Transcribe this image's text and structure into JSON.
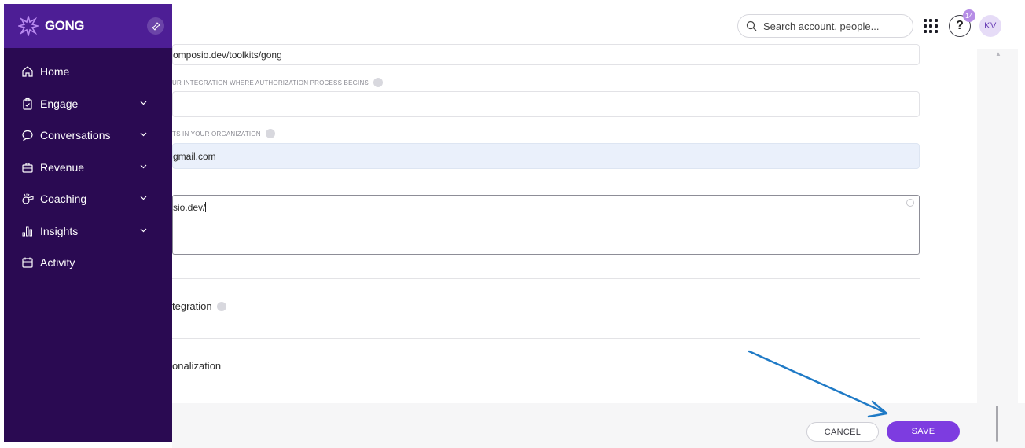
{
  "topbar": {
    "search_placeholder": "Search account, people...",
    "notif_count": "14",
    "help_label": "?",
    "avatar_initials": "KV"
  },
  "sidebar": {
    "logo": "GONG",
    "items": [
      {
        "label": "Home",
        "icon": "home-icon",
        "chevron": false
      },
      {
        "label": "Engage",
        "icon": "clipboard-icon",
        "chevron": true
      },
      {
        "label": "Conversations",
        "icon": "chat-icon",
        "chevron": true
      },
      {
        "label": "Revenue",
        "icon": "briefcase-icon",
        "chevron": true
      },
      {
        "label": "Coaching",
        "icon": "whistle-icon",
        "chevron": true
      },
      {
        "label": "Insights",
        "icon": "bar-chart-icon",
        "chevron": true
      },
      {
        "label": "Activity",
        "icon": "calendar-icon",
        "chevron": false
      }
    ]
  },
  "form": {
    "field1_value": "omposio.dev/toolkits/gong",
    "field2_label": "UR INTEGRATION WHERE AUTHORIZATION PROCESS BEGINS",
    "field2_value": "",
    "field3_label": "TS IN YOUR ORGANIZATION",
    "field3_value": "gmail.com",
    "textarea_value": "sio.dev/",
    "section1": "tegration",
    "section2": "onalization"
  },
  "footer": {
    "cancel_label": "CANCEL",
    "save_label": "SAVE"
  },
  "colors": {
    "sidebar_bg": "#2a0a52",
    "sidebar_head": "#4d1e95",
    "accent": "#7d3ce0",
    "annotation_arrow": "#1f7ac6"
  }
}
